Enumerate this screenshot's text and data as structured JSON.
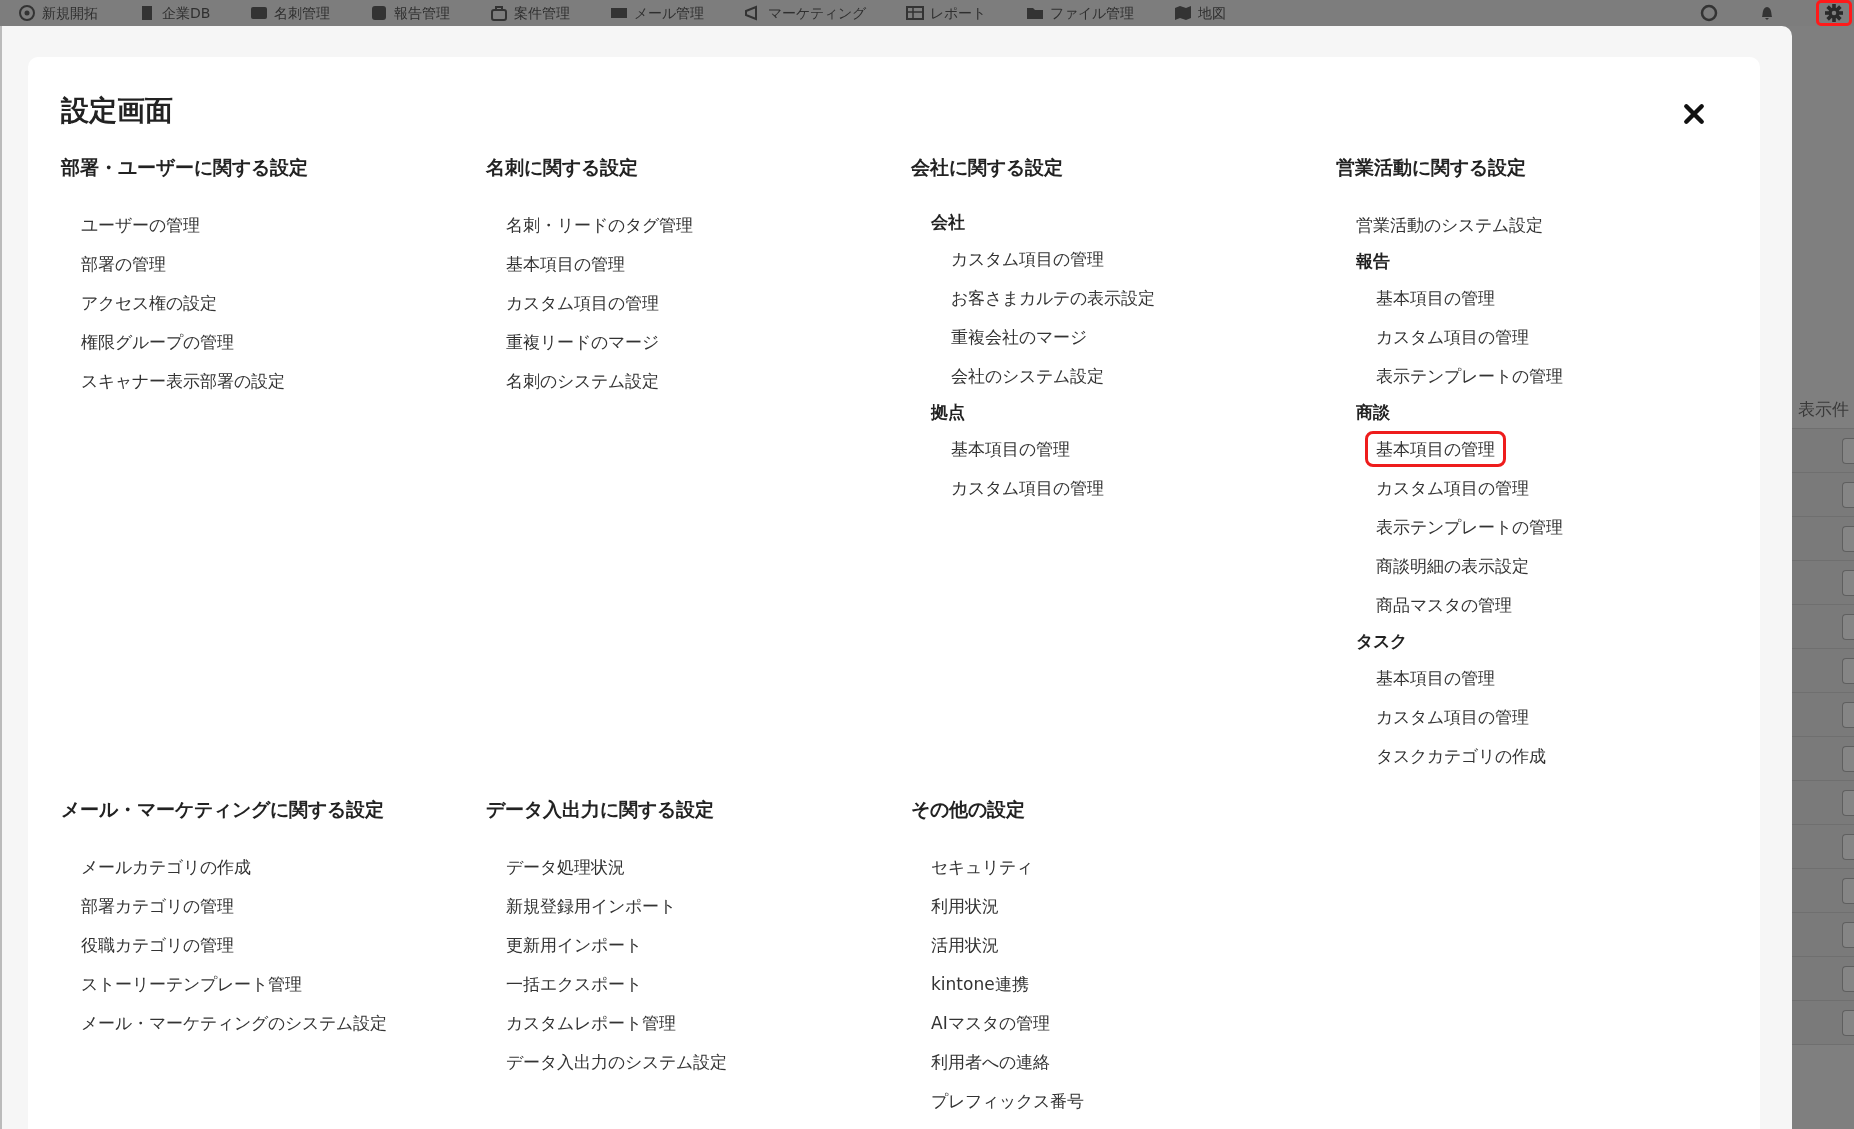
{
  "nav": {
    "items": [
      {
        "label": "新規開拓"
      },
      {
        "label": "企業DB"
      },
      {
        "label": "名刺管理"
      },
      {
        "label": "報告管理"
      },
      {
        "label": "案件管理"
      },
      {
        "label": "メール管理"
      },
      {
        "label": "マーケティング"
      },
      {
        "label": "レポート"
      },
      {
        "label": "ファイル管理"
      },
      {
        "label": "地図"
      }
    ],
    "settings_highlighted": true
  },
  "dialog": {
    "title": "設定画面",
    "sections": [
      {
        "title": "部署・ユーザーに関する設定",
        "groups": [
          {
            "items": [
              {
                "label": "ユーザーの管理",
                "highlighted": false
              },
              {
                "label": "部署の管理",
                "highlighted": false
              },
              {
                "label": "アクセス権の設定",
                "highlighted": false
              },
              {
                "label": "権限グループの管理",
                "highlighted": false
              },
              {
                "label": "スキャナー表示部署の設定",
                "highlighted": false
              }
            ]
          }
        ]
      },
      {
        "title": "名刺に関する設定",
        "groups": [
          {
            "items": [
              {
                "label": "名刺・リードのタグ管理",
                "highlighted": false
              },
              {
                "label": "基本項目の管理",
                "highlighted": false
              },
              {
                "label": "カスタム項目の管理",
                "highlighted": false
              },
              {
                "label": "重複リードのマージ",
                "highlighted": false
              },
              {
                "label": "名刺のシステム設定",
                "highlighted": false
              }
            ]
          }
        ]
      },
      {
        "title": "会社に関する設定",
        "groups": [
          {
            "label": "会社",
            "items": [
              {
                "label": "カスタム項目の管理",
                "highlighted": false
              },
              {
                "label": "お客さまカルテの表示設定",
                "highlighted": false
              },
              {
                "label": "重複会社のマージ",
                "highlighted": false
              },
              {
                "label": "会社のシステム設定",
                "highlighted": false
              }
            ]
          },
          {
            "label": "拠点",
            "items": [
              {
                "label": "基本項目の管理",
                "highlighted": false
              },
              {
                "label": "カスタム項目の管理",
                "highlighted": false
              }
            ]
          }
        ]
      },
      {
        "title": "営業活動に関する設定",
        "groups": [
          {
            "items": [
              {
                "label": "営業活動のシステム設定",
                "highlighted": false
              }
            ]
          },
          {
            "label": "報告",
            "items": [
              {
                "label": "基本項目の管理",
                "highlighted": false
              },
              {
                "label": "カスタム項目の管理",
                "highlighted": false
              },
              {
                "label": "表示テンプレートの管理",
                "highlighted": false
              }
            ]
          },
          {
            "label": "商談",
            "items": [
              {
                "label": "基本項目の管理",
                "highlighted": true
              },
              {
                "label": "カスタム項目の管理",
                "highlighted": false
              },
              {
                "label": "表示テンプレートの管理",
                "highlighted": false
              },
              {
                "label": "商談明細の表示設定",
                "highlighted": false
              },
              {
                "label": "商品マスタの管理",
                "highlighted": false
              }
            ]
          },
          {
            "label": "タスク",
            "items": [
              {
                "label": "基本項目の管理",
                "highlighted": false
              },
              {
                "label": "カスタム項目の管理",
                "highlighted": false
              },
              {
                "label": "タスクカテゴリの作成",
                "highlighted": false
              }
            ]
          }
        ]
      },
      {
        "title": "メール・マーケティングに関する設定",
        "groups": [
          {
            "items": [
              {
                "label": "メールカテゴリの作成",
                "highlighted": false
              },
              {
                "label": "部署カテゴリの管理",
                "highlighted": false
              },
              {
                "label": "役職カテゴリの管理",
                "highlighted": false
              },
              {
                "label": "ストーリーテンプレート管理",
                "highlighted": false
              },
              {
                "label": "メール・マーケティングのシステム設定",
                "highlighted": false
              }
            ]
          }
        ]
      },
      {
        "title": "データ入出力に関する設定",
        "groups": [
          {
            "items": [
              {
                "label": "データ処理状況",
                "highlighted": false
              },
              {
                "label": "新規登録用インポート",
                "highlighted": false
              },
              {
                "label": "更新用インポート",
                "highlighted": false
              },
              {
                "label": "一括エクスポート",
                "highlighted": false
              },
              {
                "label": "カスタムレポート管理",
                "highlighted": false
              },
              {
                "label": "データ入出力のシステム設定",
                "highlighted": false
              }
            ]
          }
        ]
      },
      {
        "title": "その他の設定",
        "groups": [
          {
            "items": [
              {
                "label": "セキュリティ",
                "highlighted": false
              },
              {
                "label": "利用状況",
                "highlighted": false
              },
              {
                "label": "活用状況",
                "highlighted": false
              },
              {
                "label": "kintone連携",
                "highlighted": false
              },
              {
                "label": "AIマスタの管理",
                "highlighted": false
              },
              {
                "label": "利用者への連絡",
                "highlighted": false
              },
              {
                "label": "プレフィックス番号",
                "highlighted": false
              }
            ]
          }
        ]
      }
    ]
  },
  "background_page": {
    "column_label": "表示件"
  }
}
